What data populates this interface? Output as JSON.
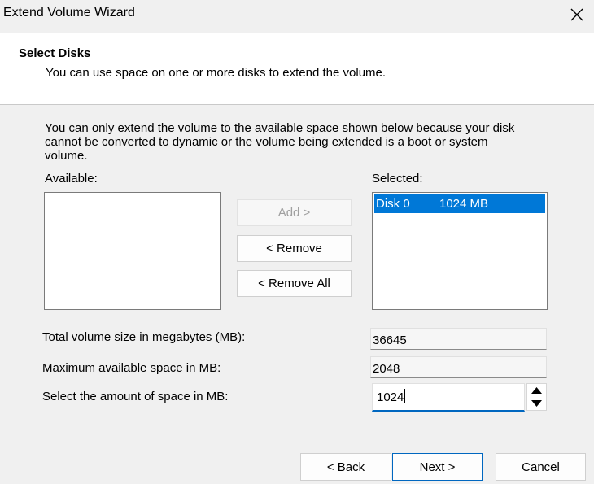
{
  "window": {
    "title": "Extend Volume Wizard"
  },
  "header": {
    "title": "Select Disks",
    "subtitle": "You can use space on one or more disks to extend the volume."
  },
  "info": {
    "line1": "You can only extend the volume to the available space shown below because your disk",
    "line2": "cannot be converted to dynamic or the volume being extended is a boot or system",
    "line3": "volume."
  },
  "available": {
    "label": "Available:",
    "items": []
  },
  "selected": {
    "label": "Selected:",
    "items": [
      {
        "disk": "Disk 0",
        "size": "1024 MB"
      }
    ]
  },
  "buttons": {
    "add": "Add >",
    "remove": "< Remove",
    "remove_all": "< Remove All",
    "back": "< Back",
    "next": "Next >",
    "cancel": "Cancel"
  },
  "fields": {
    "total_label": "Total volume size in megabytes (MB):",
    "total_value": "36645",
    "max_label": "Maximum available space in MB:",
    "max_value": "2048",
    "amount_label": "Select the amount of space in MB:",
    "amount_value": "1024"
  },
  "colors": {
    "accent": "#0078d7",
    "background": "#f0f0f0",
    "header_bg": "#ffffff"
  },
  "icons": {
    "close": "close-icon",
    "spin_up": "arrow-up-icon",
    "spin_down": "arrow-down-icon"
  }
}
